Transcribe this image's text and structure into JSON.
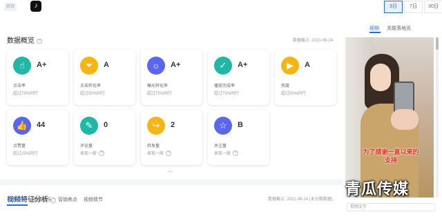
{
  "topbar": {
    "tag": "综合",
    "ranges": [
      "3日",
      "7日",
      "30日"
    ],
    "active_range": "3日"
  },
  "overview": {
    "title": "数据概览",
    "deadline": "数据截止: 2021-08-24",
    "cards": [
      {
        "icon": "click-icon",
        "grade": "A+",
        "name": "点击率",
        "sub": "超过75%同行",
        "color": "#1fb8a4"
      },
      {
        "icon": "filter-icon",
        "grade": "A",
        "name": "点击转化率",
        "sub": "超过50%同行",
        "color": "#f6b513"
      },
      {
        "icon": "sun-icon",
        "grade": "A+",
        "name": "曝光转化率",
        "sub": "超过75%同行",
        "color": "#5a66f0"
      },
      {
        "icon": "check-icon",
        "grade": "A+",
        "name": "播放完成率",
        "sub": "超过75%同行",
        "color": "#1fb8a4"
      },
      {
        "icon": "play-icon",
        "grade": "A",
        "name": "热度",
        "sub": "超过50%同行",
        "color": "#f6b513"
      },
      {
        "icon": "thumbs-up-icon",
        "grade": "44",
        "name": "点赞量",
        "sub": "超过25%同行",
        "color": "#5a66f0"
      },
      {
        "icon": "comment-icon",
        "grade": "0",
        "name": "评论量",
        "sub": "表现一般",
        "color": "#1fb8a4"
      },
      {
        "icon": "share-icon",
        "grade": "2",
        "name": "转发量",
        "sub": "表现一般",
        "color": "#f6b513"
      },
      {
        "icon": "star-icon",
        "grade": "B",
        "name": "关注量",
        "sub": "表现一般",
        "color": "#5a66f0"
      }
    ]
  },
  "features": {
    "title": "视频特征分析",
    "deadline": "数据截止: 2021-08-24 (未分数数据)",
    "tabs": [
      "视频类型",
      "视频音乐",
      "营销卖点",
      "视频情节"
    ],
    "active_tab": "视频类型"
  },
  "side": {
    "tabs": [
      "视频",
      "关联落地页"
    ],
    "active_tab": "视频",
    "caption_line1": "为了感谢一直以来的",
    "caption_line2": "支持",
    "field_text": "视频文字"
  },
  "watermark": "青瓜传媒"
}
